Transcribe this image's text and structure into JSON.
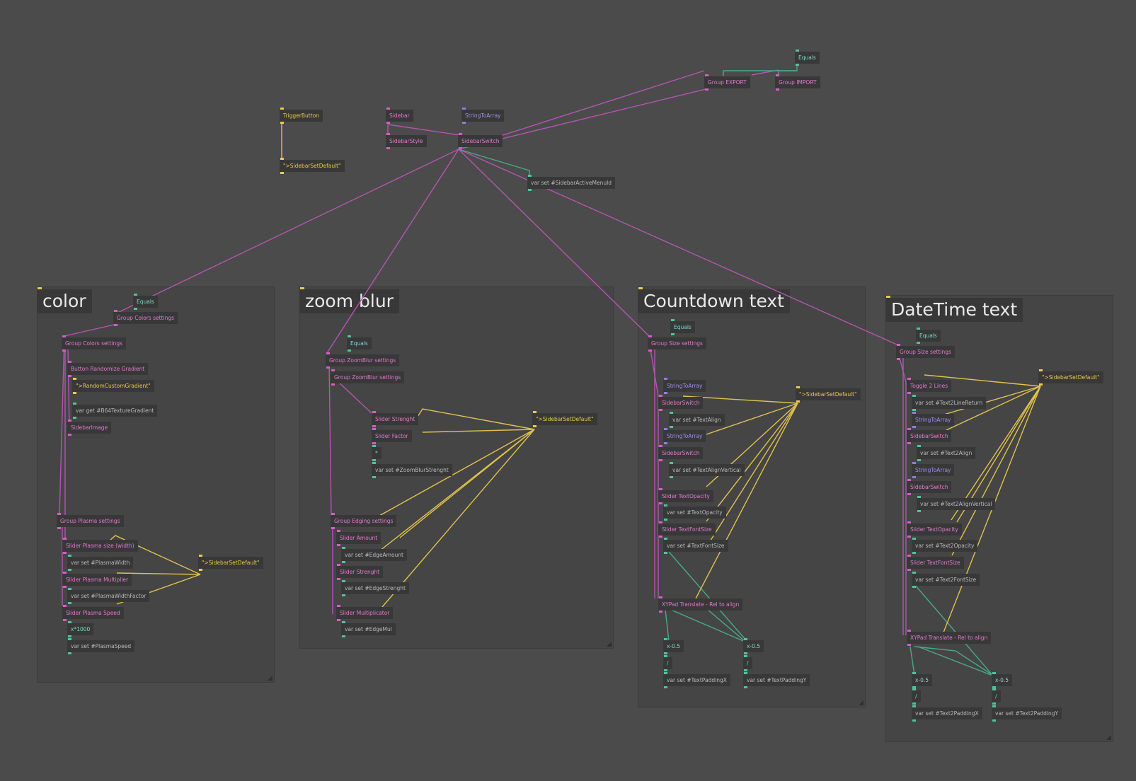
{
  "colors": {
    "background": "#4b4b4b",
    "area": "#454545",
    "node": "#383838",
    "wire_object": "#b455b0",
    "wire_string": "#e1c24c",
    "wire_number": "#4aa88a",
    "pin_object": "#d45ec6",
    "pin_string": "#f0c84a",
    "pin_number": "#4fc3a0",
    "pin_array": "#8f7ee0"
  },
  "areas": {
    "color": {
      "title": "color"
    },
    "zoom_blur": {
      "title": "zoom blur"
    },
    "countdown": {
      "title": "Countdown text"
    },
    "datetime": {
      "title": "DateTime text"
    }
  },
  "nodes": {
    "equals_top": "Equals",
    "group_export": "Group EXPORT",
    "group_import": "Group IMPORT",
    "trigger_button": "TriggerButton",
    "sidebar": "Sidebar",
    "string_to_array_top": "StringToArray",
    "sidebar_style": "SidebarStyle",
    "sidebar_switch_top": "SidebarSwitch",
    "sidebar_set_default_top": "\">SidebarSetDefault\"",
    "var_set_active_menu": "var set #SidebarActiveMenuId",
    "c_equals": "Equals",
    "c_group_colors_settings_1": "Group Colors settings",
    "c_group_colors_settings_2": "Group Colors settings",
    "c_button_randomize": "Button Randomize Gradient",
    "c_random_custom_gradient": "\">RandomCustomGradient\"",
    "c_var_get_texture": "var get #B64TextureGradient",
    "c_sidebar_image": "SidebarImage",
    "c_group_plasma": "Group Plasma settings",
    "c_slider_plasma_size": "Slider Plasma size (width)",
    "c_var_set_plasma_width": "var set #PlasmaWidth",
    "c_slider_plasma_mult": "Slider Plasma Multiplier",
    "c_var_set_plasma_width_factor": "var set #PlasmaWidthFactor",
    "c_slider_plasma_speed": "Slider Plasma Speed",
    "c_expr_x1000": "x*1000",
    "c_var_set_plasma_speed": "var set #PlasmaSpeed",
    "c_sidebar_set_default": "\">SidebarSetDefault\"",
    "z_equals": "Equals",
    "z_group_zoomblur_1": "Group ZoomBlur settings",
    "z_group_zoomblur_2": "Group ZoomBlur settings",
    "z_slider_strenght": "Slider Strenght",
    "z_slider_factor": "Slider Factor",
    "z_mult": "*",
    "z_var_set_zoomblur_strenght": "var set #ZoomBlurStrenght",
    "z_sidebar_set_default": "\">SidebarSetDefault\"",
    "z_group_edging": "Group Edging settings",
    "z_slider_amount": "Slider Amount",
    "z_var_set_edge_amount": "var set #EdgeAmount",
    "z_slider_strenght_2": "Slider Strenght",
    "z_var_set_edge_strenght": "var set #EdgeStrenght",
    "z_slider_multiplicator": "Slider Multiplicator",
    "z_var_set_edge_mul": "var set #EdgeMul",
    "t_equals": "Equals",
    "t_group_size": "Group Size settings",
    "t_string_to_array_1": "StringToArray",
    "t_sidebar_switch_1": "SidebarSwitch",
    "t_var_set_text_align": "var set #TextAlign",
    "t_string_to_array_2": "StringToArray",
    "t_sidebar_switch_2": "SidebarSwitch",
    "t_var_set_text_align_vertical": "var set #TextAlignVertical",
    "t_slider_text_opacity": "Slider TextOpacity",
    "t_var_set_text_opacity": "var set #TextOpacity",
    "t_slider_text_font_size": "Slider TextFontSize",
    "t_var_set_text_font_size": "var set #TextFontSize",
    "t_xypad": "XYPad Translate - Rel to align",
    "t_sidebar_set_default": "\">SidebarSetDefault\"",
    "t_x_minus_a": "x-0.5",
    "t_x_minus_b": "x-0.5",
    "t_div_a": "/",
    "t_div_b": "/",
    "t_var_set_padding_x": "var set #TextPaddingX",
    "t_var_set_padding_y": "var set #TextPaddingY",
    "d_equals": "Equals",
    "d_group_size": "Group Size settings",
    "d_toggle_2_lines": "Toggle 2 Lines",
    "d_var_set_text2_line_return": "var set #Text2LineReturn",
    "d_string_to_array_1": "StringToArray",
    "d_sidebar_switch_1": "SidebarSwitch",
    "d_var_set_text2_align": "var set #Text2Align",
    "d_string_to_array_2": "StringToArray",
    "d_sidebar_switch_2": "SidebarSwitch",
    "d_var_set_text2_align_vertical": "var set #Text2AlignVertical",
    "d_slider_text_opacity": "Slider TextOpacity",
    "d_var_set_text2_opacity": "var set #Text2Opacity",
    "d_slider_text_font_size": "Slider TextFontSize",
    "d_var_set_text2_font_size": "var set #Text2FontSize",
    "d_xypad": "XYPad Translate - Rel to align",
    "d_sidebar_set_default": "\">SidebarSetDefault\"",
    "d_x_minus_a": "x-0.5",
    "d_x_minus_b": "x-0.5",
    "d_div_a": "/",
    "d_div_b": "/",
    "d_var_set_padding_x": "var set #Text2PaddingX",
    "d_var_set_padding_y": "var set #Text2PaddingY"
  }
}
